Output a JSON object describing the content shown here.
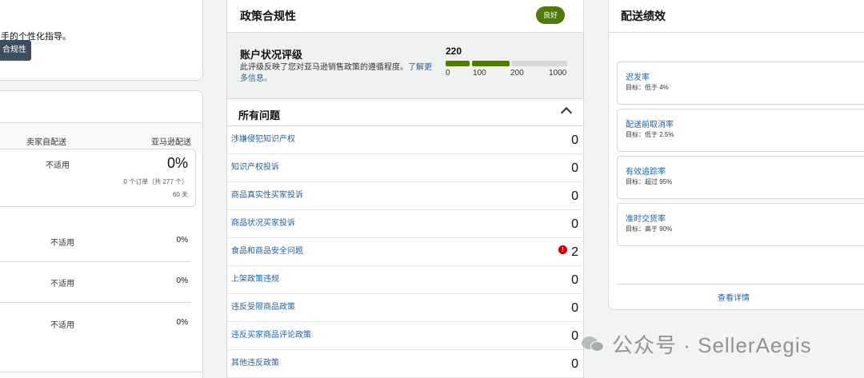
{
  "left_top": {
    "guide_text": "手的个性化指导。",
    "button_label": "合规性"
  },
  "left_metrics": {
    "columns": [
      "卖家自配送",
      "亚马逊配送"
    ],
    "card": {
      "merchant_value": "不适用",
      "fba_value": "0%",
      "orders_note": "0 个订单（共 277 个）",
      "period": "60 天"
    },
    "rows": [
      {
        "merchant": "不适用",
        "fba": "0%"
      },
      {
        "merchant": "不适用",
        "fba": "0%"
      },
      {
        "merchant": "不适用",
        "fba": "0%"
      }
    ]
  },
  "policy": {
    "title": "政策合规性",
    "badge": "良好",
    "account_health": {
      "title": "账户状况评级",
      "description": "此评级反映了您对亚马逊销售政策的遵循程度。",
      "learn_more": "了解更多信息。",
      "score": "220",
      "ticks": [
        "0",
        "100",
        "200",
        "1000"
      ],
      "score_value": 220,
      "scale_max": 1000
    },
    "issues_title": "所有问题",
    "issues": [
      {
        "name": "涉嫌侵犯知识产权",
        "count": "0",
        "alert": false
      },
      {
        "name": "知识产权投诉",
        "count": "0",
        "alert": false
      },
      {
        "name": "商品真实性买家投诉",
        "count": "0",
        "alert": false
      },
      {
        "name": "商品状况买家投诉",
        "count": "0",
        "alert": false
      },
      {
        "name": "食品和商品安全问题",
        "count": "2",
        "alert": true
      },
      {
        "name": "上架政策违规",
        "count": "0",
        "alert": false
      },
      {
        "name": "违反受限商品政策",
        "count": "0",
        "alert": false
      },
      {
        "name": "违反买家商品评论政策",
        "count": "0",
        "alert": false
      },
      {
        "name": "其他违反政策",
        "count": "0",
        "alert": false
      }
    ]
  },
  "shipping": {
    "title": "配送绩效",
    "metrics": [
      {
        "name": "迟发率",
        "target": "目标：低于 4%"
      },
      {
        "name": "配送前取消率",
        "target": "目标：低于 2.5%"
      },
      {
        "name": "有效追踪率",
        "target": "目标：超过 95%"
      },
      {
        "name": "准时交货率",
        "target": "目标：高于 90%"
      }
    ],
    "details_link": "查看详情"
  },
  "watermark": {
    "text": "公众号 · SellerAegis"
  },
  "colors": {
    "good_green": "#507b0a",
    "alert_red": "#c40000",
    "link_blue": "#2162a1",
    "bar_gray": "#d5d9d9"
  }
}
